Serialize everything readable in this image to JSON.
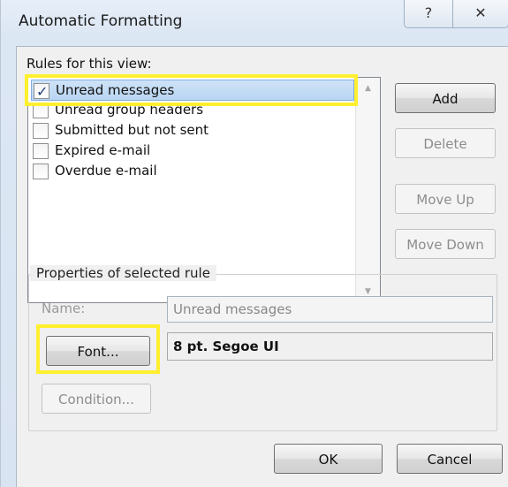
{
  "window": {
    "title": "Automatic Formatting",
    "help_glyph": "?",
    "close_glyph": "✕"
  },
  "rules": {
    "label": "Rules for this view:",
    "items": [
      {
        "label": "Unread messages",
        "checked": true,
        "selected": true
      },
      {
        "label": "Unread group headers",
        "checked": false,
        "selected": false
      },
      {
        "label": "Submitted but not sent",
        "checked": false,
        "selected": false
      },
      {
        "label": "Expired e-mail",
        "checked": false,
        "selected": false
      },
      {
        "label": "Overdue e-mail",
        "checked": false,
        "selected": false
      }
    ],
    "check_glyph": "✓",
    "scroll_up_glyph": "▲",
    "scroll_down_glyph": "▼"
  },
  "buttons": {
    "add": "Add",
    "delete": "Delete",
    "move_up": "Move Up",
    "move_down": "Move Down",
    "ok": "OK",
    "cancel": "Cancel"
  },
  "properties": {
    "title": "Properties of selected rule",
    "name_label": "Name:",
    "name_value": "Unread messages",
    "font_button": "Font...",
    "font_value": "8 pt. Segoe UI",
    "condition_button": "Condition..."
  },
  "colors": {
    "highlight": "#ffef2e",
    "selection": "#b8d5f2"
  }
}
